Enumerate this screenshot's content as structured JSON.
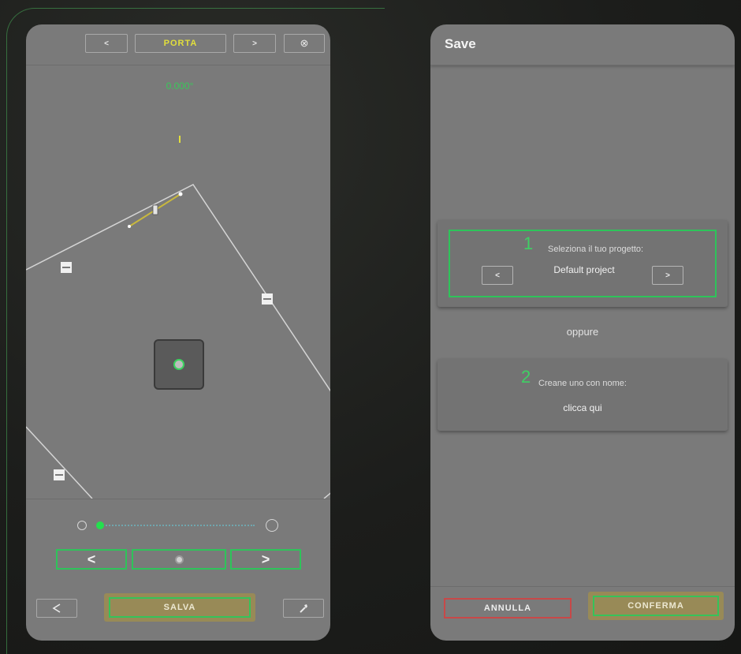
{
  "left_screen": {
    "toolbar": {
      "prev_label": "<",
      "title": "PORTA",
      "next_label": ">",
      "close_icon": "close-circle-icon"
    },
    "angle_readout": "0.000°",
    "navigation": {
      "back_label": "<",
      "forward_label": ">"
    },
    "save_label": "SALVA",
    "share_icon": "share-icon",
    "wrench_icon": "wrench-icon"
  },
  "right_screen": {
    "header_title": "Save",
    "project_card": {
      "step_number": "1",
      "label": "Seleziona il tuo progetto:",
      "selected_project": "Default project",
      "prev_label": "<",
      "next_label": ">"
    },
    "separator_text": "oppure",
    "create_card": {
      "step_number": "2",
      "label": "Creane uno con nome:",
      "link_text": "clicca qui"
    },
    "cancel_label": "ANNULLA",
    "confirm_label": "CONFERMA"
  },
  "colors": {
    "accent_green": "#2ec45a",
    "title_yellow": "#e2df3c",
    "cancel_red": "#c84848",
    "gold_button": "#988a57",
    "screen_gray": "#7a7a7a"
  }
}
